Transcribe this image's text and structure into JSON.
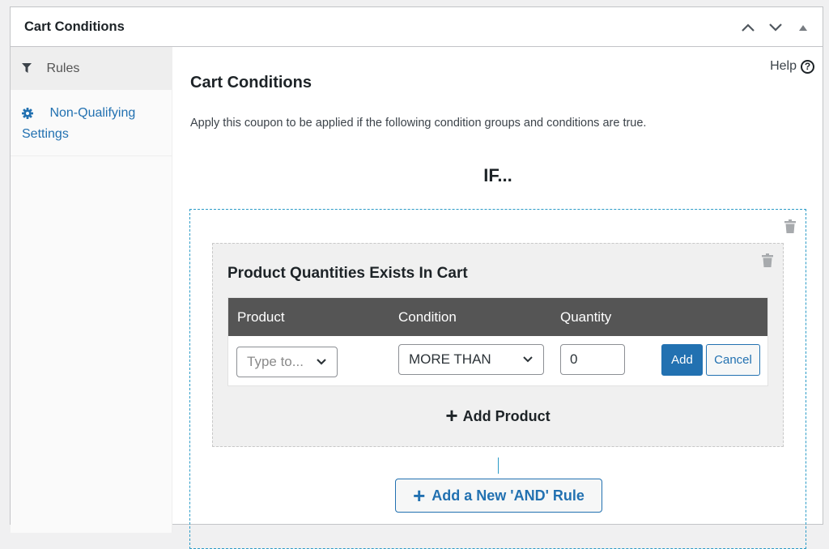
{
  "panel": {
    "title": "Cart Conditions",
    "actions": [
      {
        "name": "move-up",
        "icon": "chevron-up-icon"
      },
      {
        "name": "move-down",
        "icon": "chevron-down-icon"
      },
      {
        "name": "toggle-panel",
        "icon": "triangle-up-icon"
      }
    ]
  },
  "sidebar": {
    "items": [
      {
        "label": "Rules",
        "icon": "filter-icon",
        "active": true
      },
      {
        "label": "Non-Qualifying Settings",
        "icon": "gear-icon",
        "active": false
      }
    ]
  },
  "main": {
    "help_label": "Help",
    "help_icon": "?",
    "title": "Cart Conditions",
    "description": "Apply this coupon to be applied if the following condition groups and conditions are true.",
    "if_label": "IF..."
  },
  "rule": {
    "title": "Product Quantities Exists In Cart",
    "columns": [
      "Product",
      "Condition",
      "Quantity"
    ],
    "row": {
      "product_placeholder": "Type to...",
      "condition_value": "MORE THAN",
      "quantity_value": "0",
      "add_label": "Add",
      "cancel_label": "Cancel"
    },
    "add_product_label": "Add Product",
    "add_product_icon": "+"
  },
  "add_and_rule": {
    "icon": "+",
    "label": "Add a New 'AND' Rule"
  },
  "colors": {
    "accent": "#2271b1",
    "dashed_border": "#2b9bc7",
    "table_header": "#555555"
  }
}
